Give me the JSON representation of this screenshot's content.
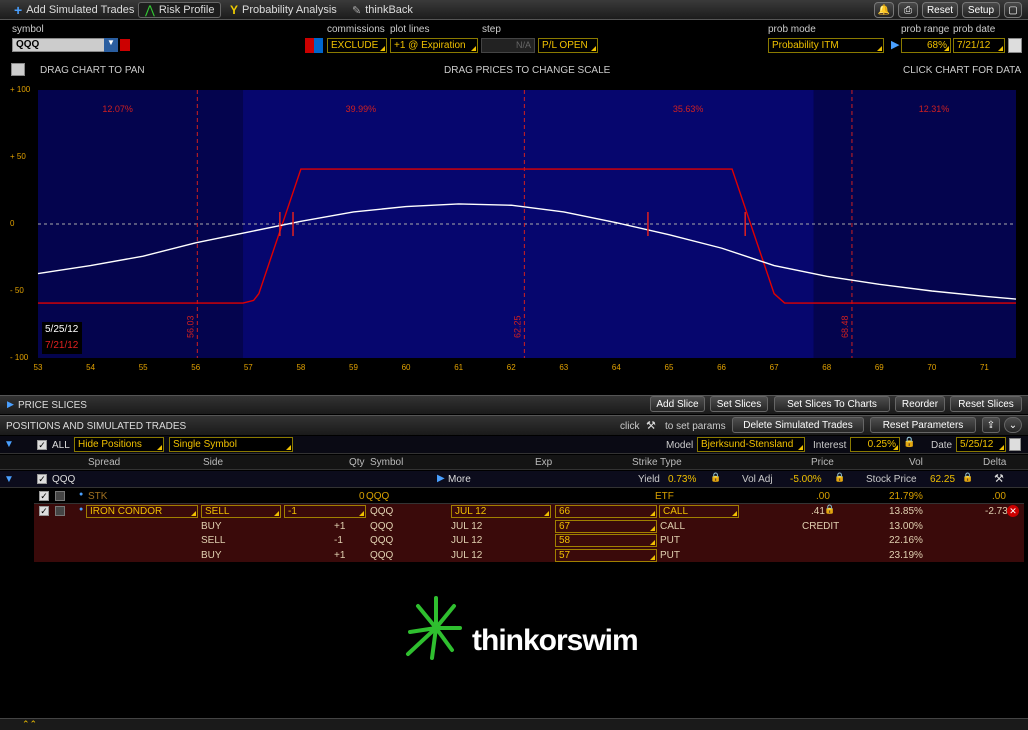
{
  "tabs": [
    {
      "label": "Add Simulated Trades",
      "icon": "plus-icon"
    },
    {
      "label": "Risk Profile",
      "icon": "risk-profile-icon",
      "active": true
    },
    {
      "label": "Probability Analysis",
      "icon": "probability-icon"
    },
    {
      "label": "thinkBack",
      "icon": "thinkback-icon"
    }
  ],
  "top_buttons": {
    "reset": "Reset",
    "setup": "Setup"
  },
  "controls": {
    "symbol_label": "symbol",
    "symbol_value": "QQQ",
    "commissions_label": "commissions",
    "commissions_value": "EXCLUDE",
    "plot_lines_label": "plot lines",
    "plot_lines_value": "+1 @ Expiration",
    "step_label": "step",
    "step_value": "N/A",
    "pl_value": "P/L OPEN",
    "prob_mode_label": "prob mode",
    "prob_mode_value": "Probability ITM",
    "prob_range_label": "prob range",
    "prob_range_value": "68%",
    "prob_date_label": "prob date",
    "prob_date_value": "7/21/12"
  },
  "chart_hints": {
    "left": "DRAG CHART TO PAN",
    "center": "DRAG PRICES TO CHANGE SCALE",
    "right": "CLICK CHART FOR DATA"
  },
  "chart_data": {
    "type": "line",
    "xlim": [
      53,
      71.6
    ],
    "ylim": [
      -100,
      100
    ],
    "x_ticks": [
      "53",
      "54",
      "55",
      "56",
      "57",
      "58",
      "59",
      "60",
      "61",
      "62",
      "63",
      "64",
      "65",
      "66",
      "67",
      "68",
      "69",
      "70",
      "71"
    ],
    "y_ticks": [
      "+ 100",
      "+ 50",
      "0",
      "- 50",
      "- 100"
    ],
    "series": [
      {
        "color": "#e00000",
        "x": [
          53,
          56.9,
          57.1,
          57.2,
          58,
          66.2,
          67,
          67.2,
          71.6
        ],
        "y": [
          -59,
          -59,
          -57,
          -52,
          41,
          41,
          -52,
          -59,
          -59
        ]
      },
      {
        "color": "#ffffff",
        "x": [
          53,
          54,
          55,
          56,
          57,
          58,
          59,
          60,
          61,
          62,
          63,
          64,
          65,
          66,
          67,
          68,
          69,
          70,
          71,
          71.6
        ],
        "y": [
          -37,
          -31,
          -24,
          -14,
          -6,
          2,
          9,
          13,
          15,
          14,
          9,
          1,
          -8,
          -18,
          -31,
          -39,
          -45,
          -50,
          -54,
          -56
        ]
      }
    ],
    "prob_regions": [
      {
        "label": "12.07%"
      },
      {
        "label": "39.99%"
      },
      {
        "label": "35.63%"
      },
      {
        "label": "12.31%"
      }
    ],
    "vlines": [
      {
        "x": 56.03,
        "label": "56.03"
      },
      {
        "x": 62.25,
        "label": "62.25"
      },
      {
        "x": 68.48,
        "label": "68.48"
      }
    ],
    "markers_red": [
      57.6,
      57.85,
      64.6,
      66.45
    ],
    "dates": [
      "5/25/12",
      "7/21/12"
    ]
  },
  "price_slices": {
    "label": "PRICE SLICES",
    "buttons": [
      "Add Slice",
      "Set Slices",
      "Set Slices To Charts",
      "Reorder",
      "Reset Slices"
    ]
  },
  "positions": {
    "title": "POSITIONS AND SIMULATED TRADES",
    "click_text": "click",
    "params_text": "to set params",
    "delete_btn": "Delete Simulated Trades",
    "reset_params_btn": "Reset Parameters",
    "all_label": "ALL",
    "hide_positions": "Hide Positions",
    "single_symbol": "Single Symbol",
    "model_label": "Model",
    "model_value": "Bjerksund-Stensland",
    "interest_label": "Interest",
    "interest_value": "0.25%",
    "date_label": "Date",
    "date_value": "5/25/12",
    "headers": [
      "Spread",
      "Side",
      "Qty",
      "Symbol",
      "Exp",
      "Strike",
      "Type",
      "Price",
      "Vol",
      "Delta"
    ],
    "group": {
      "symbol": "QQQ",
      "more": "More",
      "yield_label": "Yield",
      "yield_value": "0.73%",
      "voladj_label": "Vol Adj",
      "voladj_value": "-5.00%",
      "stock_price_label": "Stock Price",
      "stock_price_value": "62.25"
    },
    "stk_row": {
      "spread": "STK",
      "qty": "0",
      "symbol": "QQQ",
      "type": "ETF",
      "price": ".00",
      "vol": "21.79%",
      "delta": ".00"
    },
    "rows": [
      {
        "spread": "IRON CONDOR",
        "side": "SELL",
        "qty": "-1",
        "symbol": "QQQ",
        "exp": "JUL 12",
        "strike": "66",
        "type": "CALL",
        "price": ".41",
        "vol": "13.85%",
        "delta": "-2.73"
      },
      {
        "spread": "",
        "side": "BUY",
        "qty": "+1",
        "symbol": "QQQ",
        "exp": "JUL 12",
        "strike": "67",
        "type": "CALL",
        "price": "CREDIT",
        "vol": "13.00%",
        "delta": ""
      },
      {
        "spread": "",
        "side": "SELL",
        "qty": "-1",
        "symbol": "QQQ",
        "exp": "JUL 12",
        "strike": "58",
        "type": "PUT",
        "price": "",
        "vol": "22.16%",
        "delta": ""
      },
      {
        "spread": "",
        "side": "BUY",
        "qty": "+1",
        "symbol": "QQQ",
        "exp": "JUL 12",
        "strike": "57",
        "type": "PUT",
        "price": "",
        "vol": "23.19%",
        "delta": ""
      }
    ]
  },
  "logo": "thinkorswim"
}
